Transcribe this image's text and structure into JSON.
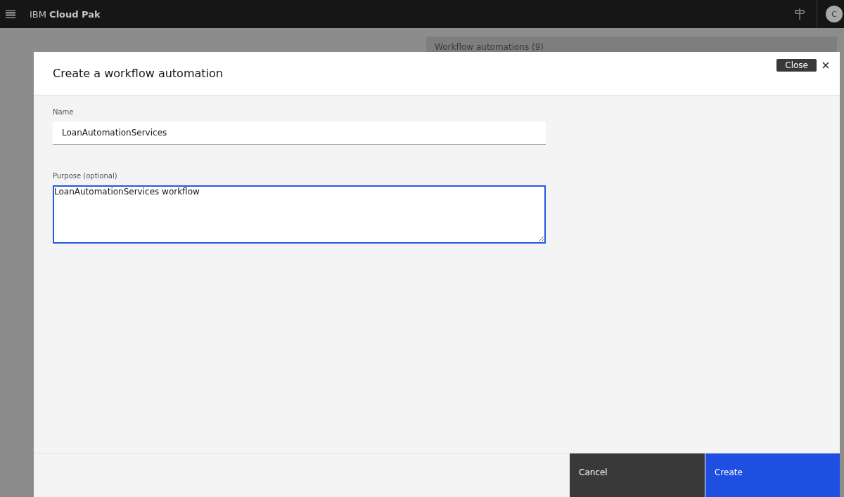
{
  "header": {
    "brand_prefix": "IBM",
    "brand_name": "Cloud Pak",
    "avatar": "C"
  },
  "background": {
    "panel_title": "Workflow automations (9)"
  },
  "modal": {
    "title": "Create a workflow automation",
    "close_tooltip": "Close",
    "fields": [
      {
        "kind": "input",
        "label": "Name",
        "value": "LoanAutomationServices",
        "focused": false
      },
      {
        "kind": "textarea",
        "label": "Purpose (optional)",
        "value": "LoanAutomationServices workflow",
        "focused": true
      }
    ],
    "buttons": [
      {
        "label": "Cancel",
        "kind": "secondary"
      },
      {
        "label": "Create",
        "kind": "primary"
      }
    ]
  }
}
